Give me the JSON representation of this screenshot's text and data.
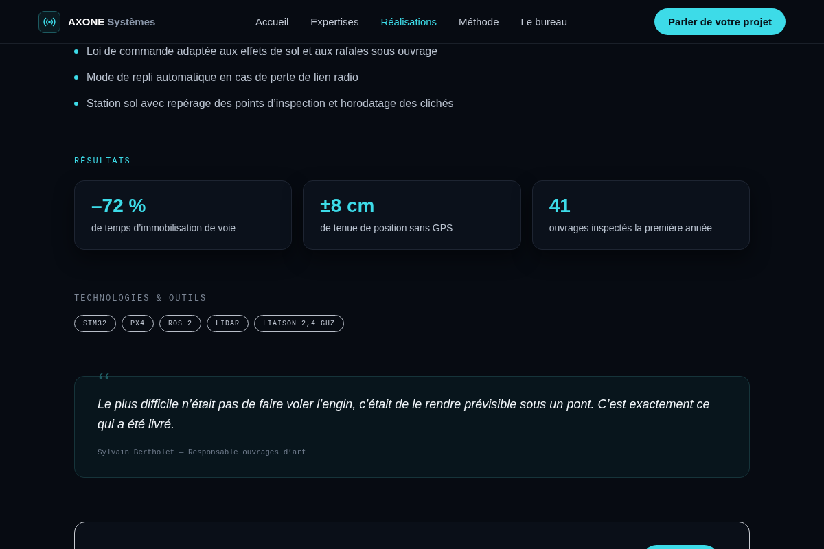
{
  "header": {
    "brand": {
      "name": "AXONE",
      "suffix": "Systèmes"
    },
    "nav": [
      {
        "label": "Accueil",
        "selected": false
      },
      {
        "label": "Expertises",
        "selected": false
      },
      {
        "label": "Réalisations",
        "selected": true
      },
      {
        "label": "Méthode",
        "selected": false
      },
      {
        "label": "Le bureau",
        "selected": false
      }
    ],
    "cta": "Parler de votre projet"
  },
  "features": [
    "Loi de commande adaptée aux effets de sol et aux rafales sous ouvrage",
    "Mode de repli automatique en cas de perte de lien radio",
    "Station sol avec repérage des points d’inspection et horodatage des clichés"
  ],
  "results": {
    "heading": "RÉSULTATS",
    "items": [
      {
        "value": "–72 %",
        "label": "de temps d’immobilisation de voie"
      },
      {
        "value": "±8 cm",
        "label": "de tenue de position sans GPS"
      },
      {
        "value": "41",
        "label": "ouvrages inspectés la première année"
      }
    ]
  },
  "technologies": {
    "heading": "TECHNOLOGIES & OUTILS",
    "tags": [
      "STM32",
      "PX4",
      "ROS 2",
      "LIDAR",
      "LIAISON 2,4 GHZ"
    ]
  },
  "testimonial": {
    "quote": "Le plus difficile n’était pas de faire voler l’engin, c’était de le rendre prévisible sous un pont. C’est exactement ce qui a été livré.",
    "author": "Sylvain Bertholet — Responsable ouvrages d’art"
  }
}
